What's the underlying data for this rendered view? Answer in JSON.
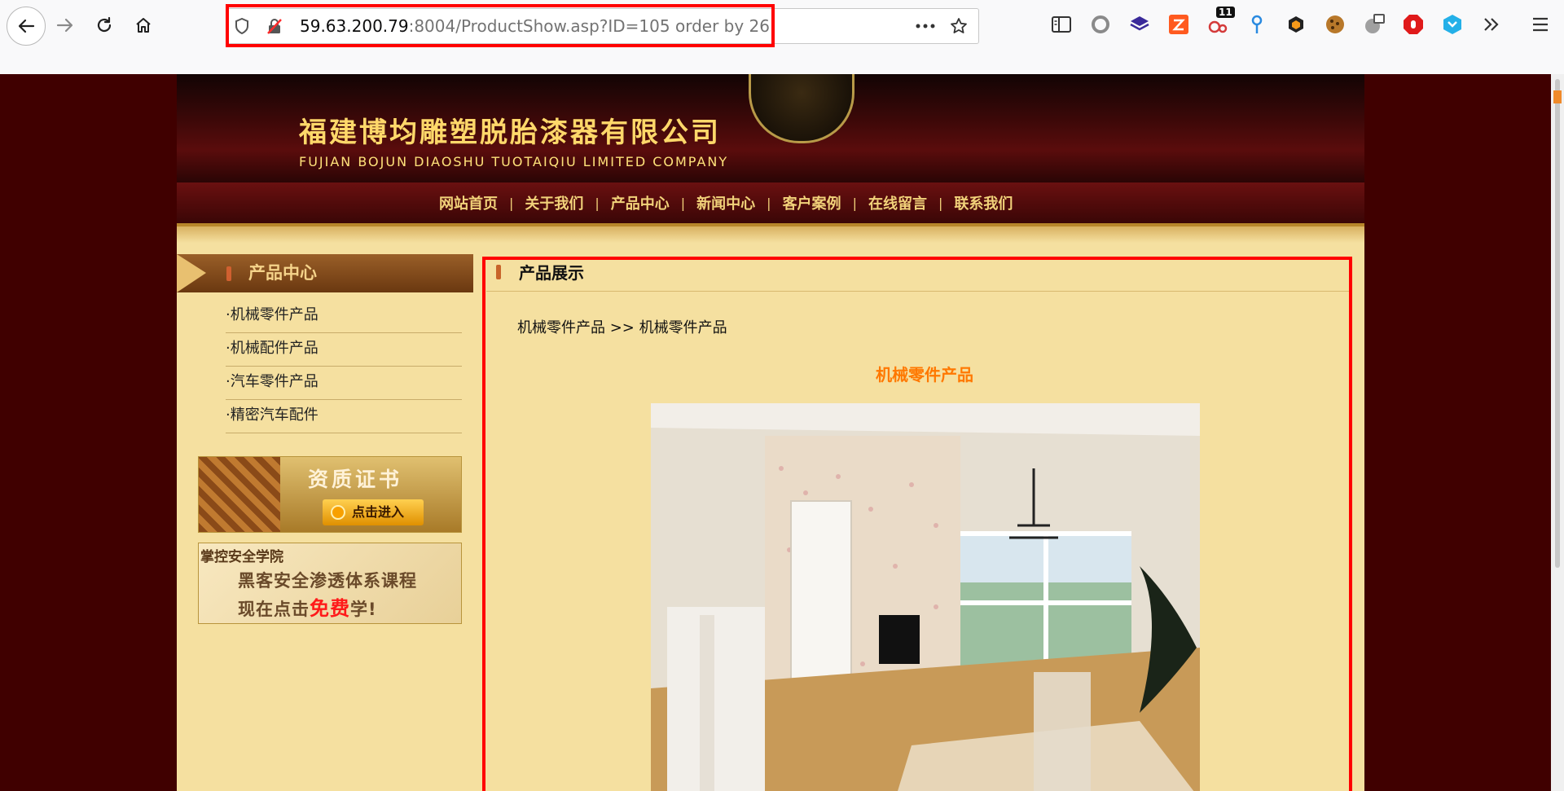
{
  "browser": {
    "url_host": "59.63.200.79",
    "url_rest": ":8004/ProductShow.asp?ID=105 order by 26",
    "extension_badge": "11",
    "icons": [
      "back-icon",
      "forward-icon",
      "reload-icon",
      "home-icon",
      "shield-icon",
      "insecure-lock-icon",
      "more-icon",
      "bookmark-star-icon",
      "sidebar-icon",
      "circle-icon",
      "stack-icon",
      "zotero-icon",
      "badge-icon",
      "pin-icon",
      "cube-icon",
      "cookie-icon",
      "mask-icon",
      "stop-icon",
      "wappalyzer-icon",
      "overflow-icon",
      "menu-icon"
    ]
  },
  "site": {
    "company_cn": "福建博均雕塑脱胎漆器有限公司",
    "company_en": "FUJIAN BOJUN DIAOSHU  TUOTAIQIU  LIMITED COMPANY",
    "nav": [
      "网站首页",
      "关于我们",
      "产品中心",
      "新闻中心",
      "客户案例",
      "在线留言",
      "联系我们"
    ],
    "nav_sep": "|",
    "sidebar": {
      "title": "产品中心",
      "items": [
        "·机械零件产品",
        "·机械配件产品",
        "·汽车零件产品",
        "·精密汽车配件"
      ]
    },
    "cert": {
      "title": "资质证书",
      "button": "点击进入"
    },
    "ad": {
      "title": "掌控安全学院",
      "line1": "黑客安全渗透体系课程",
      "line2_pre": "现在点击",
      "line2_free": "免费",
      "line2_post": "学!"
    },
    "main": {
      "title": "产品展示",
      "breadcrumb": "机械零件产品 >> 机械零件产品",
      "product_name": "机械零件产品"
    }
  },
  "colors": {
    "highlight": "#ff0000",
    "page_bg": "#400000",
    "content_bg": "#f5e0a0",
    "product_name": "#ff7800",
    "nav_text": "#f2d27a"
  }
}
